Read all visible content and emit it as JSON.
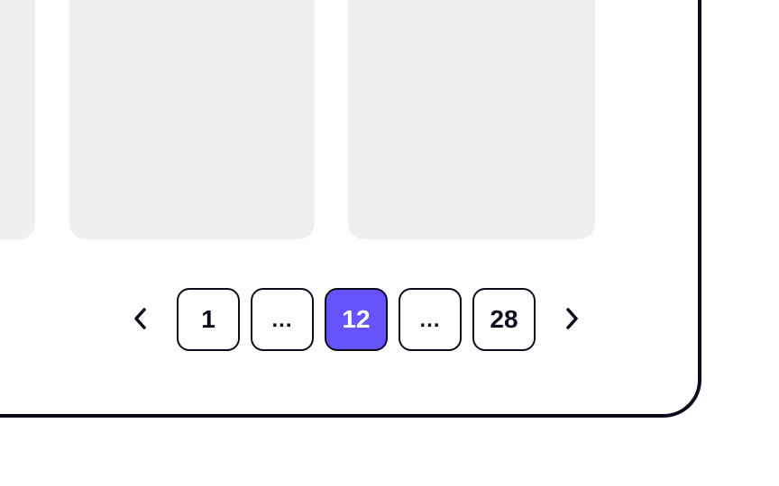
{
  "pagination": {
    "prev_icon": "chevron-left-icon",
    "next_icon": "chevron-right-icon",
    "pages": [
      {
        "label": "1",
        "active": false
      },
      {
        "label": "...",
        "active": false
      },
      {
        "label": "12",
        "active": true
      },
      {
        "label": "...",
        "active": false
      },
      {
        "label": "28",
        "active": false
      }
    ],
    "current_page": 12,
    "total_pages": 28
  },
  "colors": {
    "accent": "#6653fb",
    "border": "#0e0a1c",
    "card": "#efeff1",
    "background": "#ffffff"
  }
}
